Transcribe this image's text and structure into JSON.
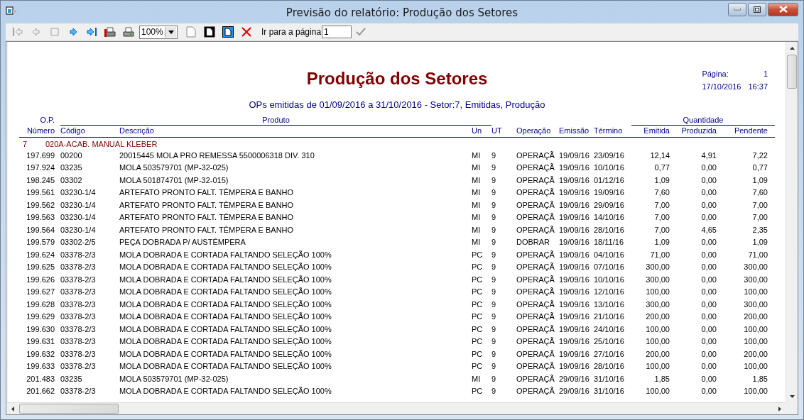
{
  "window": {
    "title": "Previsão do relatório: Produção dos Setores"
  },
  "toolbar": {
    "buttons": [
      {
        "kind": "first",
        "disabled": true
      },
      {
        "kind": "prev",
        "disabled": true
      },
      {
        "kind": "stop",
        "disabled": true
      },
      {
        "kind": "next",
        "disabled": false
      },
      {
        "kind": "last",
        "disabled": false
      },
      {
        "kind": "print-setup",
        "disabled": false
      },
      {
        "kind": "print",
        "disabled": false
      }
    ],
    "zoom": "100%",
    "page_buttons": [
      {
        "kind": "page-blank",
        "disabled": true
      },
      {
        "kind": "page-dark",
        "disabled": false
      },
      {
        "kind": "page-blue",
        "disabled": false
      },
      {
        "kind": "close",
        "disabled": false
      }
    ],
    "goto_label": "Ir para a página",
    "goto_value": "1",
    "confirm_disabled": true
  },
  "report": {
    "title": "Produção dos Setores",
    "page_label": "Página:",
    "page_number": "1",
    "date": "17/10/2016",
    "time": "16:37",
    "subtitle": "OPs emitidas de 01/09/2016 a 31/10/2016 - Setor:7, Emitidas, Produção",
    "groups": [
      "O.P.",
      "Produto",
      "Quantidade"
    ],
    "columns": [
      "Número",
      "Código",
      "Descrição",
      "Un",
      "UT",
      "Operação",
      "Emissão",
      "Término",
      "Emitida",
      "Produzida",
      "Pendente"
    ],
    "sector": {
      "code": "7",
      "name": "020A-ACAB. MANUAL KLEBER"
    },
    "rows": [
      [
        "197.699",
        "00200",
        "20015445 MOLA PRO REMESSA 5500006318 DIV. 310",
        "MI",
        "9",
        "OPERAÇÃ",
        "19/09/16",
        "23/09/16",
        "12,14",
        "4,91",
        "7,22"
      ],
      [
        "197.924",
        "03235",
        "MOLA 503579701 (MP-32-025)",
        "MI",
        "9",
        "OPERAÇÃ",
        "19/09/16",
        "10/10/16",
        "0,77",
        "0,00",
        "0,77"
      ],
      [
        "198.245",
        "03302",
        "MOLA 501874701 (MP-32-015)",
        "MI",
        "9",
        "OPERAÇÃ",
        "19/09/16",
        "01/12/16",
        "1,09",
        "0,00",
        "1,09"
      ],
      [
        "199.561",
        "03230-1/4",
        "ARTEFATO PRONTO FALT. TÊMPERA E BANHO",
        "MI",
        "9",
        "OPERAÇÃ",
        "19/09/16",
        "19/09/16",
        "7,60",
        "0,00",
        "7,60"
      ],
      [
        "199.562",
        "03230-1/4",
        "ARTEFATO PRONTO FALT. TÊMPERA E BANHO",
        "MI",
        "9",
        "OPERAÇÃ",
        "19/09/16",
        "29/09/16",
        "7,00",
        "0,00",
        "7,00"
      ],
      [
        "199.563",
        "03230-1/4",
        "ARTEFATO PRONTO FALT. TÊMPERA E BANHO",
        "MI",
        "9",
        "OPERAÇÃ",
        "19/09/16",
        "14/10/16",
        "7,00",
        "0,00",
        "7,00"
      ],
      [
        "199.564",
        "03230-1/4",
        "ARTEFATO PRONTO FALT. TÊMPERA E BANHO",
        "MI",
        "9",
        "OPERAÇÃ",
        "19/09/16",
        "28/10/16",
        "7,00",
        "4,65",
        "2,35"
      ],
      [
        "199.579",
        "03302-2/5",
        "PEÇA DOBRADA P/ AUSTÊMPERA",
        "MI",
        "9",
        "DOBRAR",
        "19/09/16",
        "18/11/16",
        "1,09",
        "0,00",
        "1,09"
      ],
      [
        "199.624",
        "03378-2/3",
        "MOLA DOBRADA E CORTADA FALTANDO SELEÇÃO 100%",
        "PC",
        "9",
        "OPERAÇÃ",
        "19/09/16",
        "04/10/16",
        "71,00",
        "0,00",
        "71,00"
      ],
      [
        "199.625",
        "03378-2/3",
        "MOLA DOBRADA E CORTADA FALTANDO SELEÇÃO 100%",
        "PC",
        "9",
        "OPERAÇÃ",
        "19/09/16",
        "07/10/16",
        "300,00",
        "0,00",
        "300,00"
      ],
      [
        "199.626",
        "03378-2/3",
        "MOLA DOBRADA E CORTADA FALTANDO SELEÇÃO 100%",
        "PC",
        "9",
        "OPERAÇÃ",
        "19/09/16",
        "10/10/16",
        "300,00",
        "0,00",
        "300,00"
      ],
      [
        "199.627",
        "03378-2/3",
        "MOLA DOBRADA E CORTADA FALTANDO SELEÇÃO 100%",
        "PC",
        "9",
        "OPERAÇÃ",
        "19/09/16",
        "12/10/16",
        "100,00",
        "0,00",
        "100,00"
      ],
      [
        "199.628",
        "03378-2/3",
        "MOLA DOBRADA E CORTADA FALTANDO SELEÇÃO 100%",
        "PC",
        "9",
        "OPERAÇÃ",
        "19/09/16",
        "13/10/16",
        "300,00",
        "0,00",
        "300,00"
      ],
      [
        "199.629",
        "03378-2/3",
        "MOLA DOBRADA E CORTADA FALTANDO SELEÇÃO 100%",
        "PC",
        "9",
        "OPERAÇÃ",
        "19/09/16",
        "21/10/16",
        "200,00",
        "0,00",
        "200,00"
      ],
      [
        "199.630",
        "03378-2/3",
        "MOLA DOBRADA E CORTADA FALTANDO SELEÇÃO 100%",
        "PC",
        "9",
        "OPERAÇÃ",
        "19/09/16",
        "24/10/16",
        "100,00",
        "0,00",
        "100,00"
      ],
      [
        "199.631",
        "03378-2/3",
        "MOLA DOBRADA E CORTADA FALTANDO SELEÇÃO 100%",
        "PC",
        "9",
        "OPERAÇÃ",
        "19/09/16",
        "25/10/16",
        "100,00",
        "0,00",
        "100,00"
      ],
      [
        "199.632",
        "03378-2/3",
        "MOLA DOBRADA E CORTADA FALTANDO SELEÇÃO 100%",
        "PC",
        "9",
        "OPERAÇÃ",
        "19/09/16",
        "27/10/16",
        "200,00",
        "0,00",
        "200,00"
      ],
      [
        "199.633",
        "03378-2/3",
        "MOLA DOBRADA E CORTADA FALTANDO SELEÇÃO 100%",
        "PC",
        "9",
        "OPERAÇÃ",
        "19/09/16",
        "28/10/16",
        "100,00",
        "0,00",
        "100,00"
      ],
      [
        "201.483",
        "03235",
        "MOLA 503579701 (MP-32-025)",
        "MI",
        "9",
        "OPERAÇÃ",
        "29/09/16",
        "31/10/16",
        "1,85",
        "0,00",
        "1,85"
      ],
      [
        "201.662",
        "03378-2/3",
        "MOLA DOBRADA E CORTADA FALTANDO SELEÇÃO 100%",
        "PC",
        "9",
        "OPERAÇÃ",
        "29/09/16",
        "31/10/16",
        "100,00",
        "0,00",
        "100,00"
      ]
    ]
  }
}
